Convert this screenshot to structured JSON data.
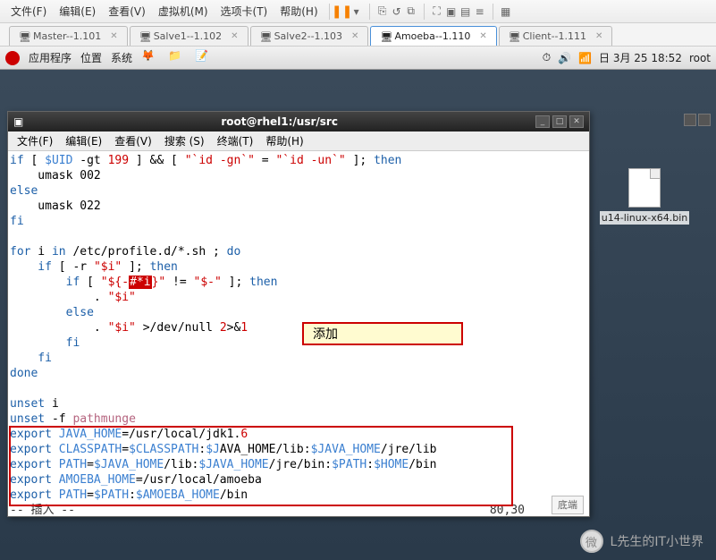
{
  "vm_menu": [
    "文件(F)",
    "编辑(E)",
    "查看(V)",
    "虚拟机(M)",
    "选项卡(T)",
    "帮助(H)"
  ],
  "tabs": [
    {
      "label": "Master--1.101",
      "active": false
    },
    {
      "label": "Salve1--1.102",
      "active": false
    },
    {
      "label": "Salve2--1.103",
      "active": false
    },
    {
      "label": "Amoeba--1.110",
      "active": true
    },
    {
      "label": "Client--1.111",
      "active": false
    }
  ],
  "gnome": {
    "apps": "应用程序",
    "places": "位置",
    "system": "系统",
    "date": "日 3月 25 18:52",
    "user": "root"
  },
  "desktop_file": "u14-linux-x64.bin",
  "terminal": {
    "title": "root@rhel1:/usr/src",
    "menu": [
      "文件(F)",
      "编辑(E)",
      "查看(V)",
      "搜索 (S)",
      "终端(T)",
      "帮助(H)"
    ],
    "lines": {
      "l1a": "if",
      "l1b": " [ ",
      "l1c": "$UID",
      "l1d": " -gt ",
      "l1e": "199",
      "l1f": " ] && [ ",
      "l1g": "\"`id -gn`\"",
      "l1h": " = ",
      "l1i": "\"`id -un`\"",
      "l1j": " ]; ",
      "l1k": "then",
      "l2": "    umask 002",
      "l3": "else",
      "l4": "    umask 022",
      "l5": "fi",
      "l7a": "for",
      "l7b": " i ",
      "l7c": "in",
      "l7d": " /etc/profile.d/*.sh ; ",
      "l7e": "do",
      "l8a": "    if",
      "l8b": " [ -r ",
      "l8c": "\"$i\"",
      "l8d": " ]; ",
      "l8e": "then",
      "l9a": "        if",
      "l9b": " [ ",
      "l9c": "\"${-",
      "l9cur": "#*i",
      "l9d": "}\"",
      "l9e": " != ",
      "l9f": "\"$-\"",
      "l9g": " ]; ",
      "l9h": "then",
      "l10a": "            . ",
      "l10b": "\"$i\"",
      "l11": "        else",
      "l12a": "            . ",
      "l12b": "\"$i\"",
      "l12c": " >/dev/null ",
      "l12d": "2",
      "l12e": ">&",
      "l12f": "1",
      "l13": "        fi",
      "l14": "    fi",
      "l15": "done",
      "l17a": "unset",
      "l17b": " i",
      "l18a": "unset",
      "l18b": " -f ",
      "l18c": "pathmunge",
      "e1a": "export",
      "e1b": " JAVA_HOME",
      "e1c": "=/usr/local/jdk1.",
      "e1d": "6",
      "e2a": "export",
      "e2b": " CLASSPATH",
      "e2c": "=",
      "e2d": "$CLASSPATH",
      "e2e": ":",
      "e2f": "$J",
      "e2g": "AVA_HOME/lib:",
      "e2h": "$JAVA_HOME",
      "e2i": "/jre/lib",
      "e3a": "export",
      "e3b": " PATH",
      "e3c": "=",
      "e3d": "$JAVA_HOME",
      "e3e": "/lib:",
      "e3f": "$JAVA_HOME",
      "e3g": "/jre/bin:",
      "e3h": "$PATH",
      "e3i": ":",
      "e3j": "$HOME",
      "e3k": "/bin",
      "e4a": "export",
      "e4b": " AMOEBA_HOME",
      "e4c": "=/usr/local/amoeba",
      "e5a": "export",
      "e5b": " PATH",
      "e5c": "=",
      "e5d": "$PATH",
      "e5e": ":",
      "e5f": "$AMOEBA_HOME",
      "e5g": "/bin",
      "status_left": "-- 插入 --",
      "status_right": "80,30"
    },
    "footer_badge": "底端"
  },
  "annotation": "添加",
  "watermark": "L先生的IT小世界"
}
